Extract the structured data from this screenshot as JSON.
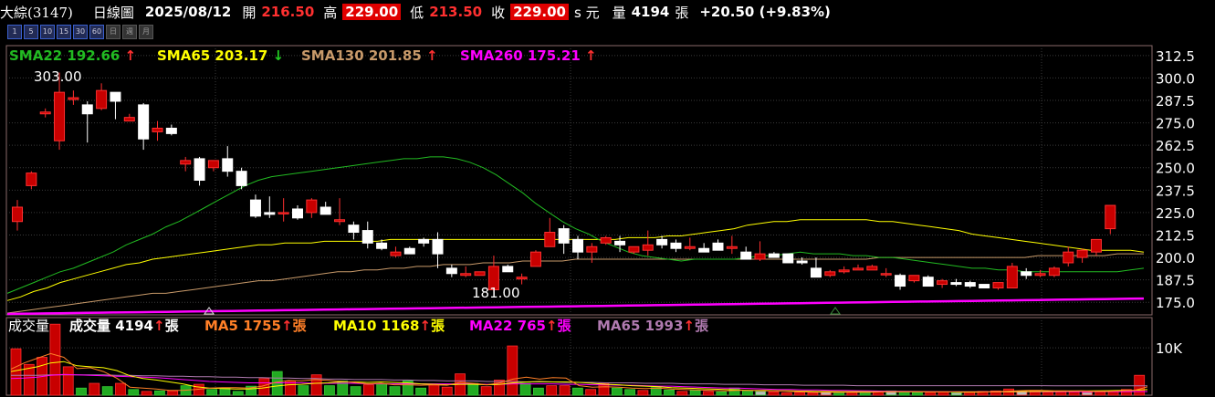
{
  "header": {
    "stock": "大綜(3147)",
    "period": "日線圖",
    "date": "2025/08/12",
    "open_label": "開",
    "open": "216.50",
    "high_label": "高",
    "high": "229.00",
    "low_label": "低",
    "low": "213.50",
    "close_label": "收",
    "close": "229.00",
    "unit": "s 元",
    "volume_label": "量",
    "volume": "4194",
    "volume_unit": "張",
    "change": "+20.50 (+9.83%)"
  },
  "period_buttons": [
    "1",
    "5",
    "10",
    "15",
    "30",
    "60",
    "日",
    "週",
    "月"
  ],
  "colors": {
    "up": "#c80000",
    "up_border": "#ff3030",
    "down": "#ffffff",
    "sma22": "#22bb22",
    "sma65": "#ffff00",
    "sma130": "#c89a6a",
    "sma260": "#ff00ff",
    "ma5": "#ff7f27",
    "ma10": "#ffff00",
    "ma22": "#ff00ff",
    "ma65": "#b07ab0",
    "grid": "#3a3a3a",
    "axis_text": "#ffffff"
  },
  "chart_data": {
    "type": "candlestick",
    "ylim": [
      168,
      318
    ],
    "y_ticks": [
      "312.5",
      "300.0",
      "287.5",
      "275.0",
      "262.5",
      "250.0",
      "237.5",
      "225.0",
      "212.5",
      "200.0",
      "187.5",
      "175.0"
    ],
    "annotations": {
      "high": "303.00",
      "low": "181.00"
    },
    "sma_legend": [
      {
        "name": "SMA22",
        "value": "192.66",
        "arrow": "↑",
        "color": "#22bb22"
      },
      {
        "name": "SMA65",
        "value": "203.17",
        "arrow": "↓",
        "color": "#ffff00"
      },
      {
        "name": "SMA130",
        "value": "201.85",
        "arrow": "↑",
        "color": "#c89a6a"
      },
      {
        "name": "SMA260",
        "value": "175.21",
        "arrow": "↑",
        "color": "#ff00ff"
      }
    ],
    "candles": [
      [
        220,
        232,
        215,
        228
      ],
      [
        240,
        248,
        238,
        247
      ],
      [
        280,
        283,
        278,
        281
      ],
      [
        265,
        303,
        260,
        292
      ],
      [
        288,
        293,
        285,
        289
      ],
      [
        285,
        287,
        264,
        280
      ],
      [
        283,
        297,
        282,
        293
      ],
      [
        292,
        292,
        277,
        287
      ],
      [
        276,
        280,
        276,
        278
      ],
      [
        285,
        286,
        260,
        266
      ],
      [
        270,
        276,
        265,
        272
      ],
      [
        272,
        274,
        268,
        269
      ],
      [
        252,
        256,
        248,
        254
      ],
      [
        255,
        256,
        240,
        243
      ],
      [
        250,
        254,
        248,
        254
      ],
      [
        255,
        262,
        245,
        248
      ],
      [
        248,
        250,
        238,
        240
      ],
      [
        232,
        235,
        222,
        223
      ],
      [
        225,
        234,
        222,
        224
      ],
      [
        225,
        233,
        220,
        225
      ],
      [
        227,
        229,
        221,
        222
      ],
      [
        225,
        233,
        222,
        232
      ],
      [
        228,
        231,
        224,
        224
      ],
      [
        220,
        233,
        218,
        221
      ],
      [
        218,
        220,
        210,
        214
      ],
      [
        215,
        220,
        205,
        208
      ],
      [
        208,
        210,
        204,
        205
      ],
      [
        201,
        206,
        200,
        203
      ],
      [
        205,
        206,
        203,
        202
      ],
      [
        210,
        211,
        206,
        208
      ],
      [
        210,
        214,
        194,
        202
      ],
      [
        194,
        196,
        189,
        191
      ],
      [
        190,
        195,
        189,
        191
      ],
      [
        190,
        192,
        190,
        192
      ],
      [
        182,
        201,
        181,
        195
      ],
      [
        195,
        196,
        192,
        192
      ],
      [
        188,
        191,
        185,
        189
      ],
      [
        195,
        204,
        195,
        203
      ],
      [
        206,
        222,
        206,
        214
      ],
      [
        216,
        218,
        202,
        208
      ],
      [
        210,
        212,
        199,
        203
      ],
      [
        203,
        208,
        197,
        206
      ],
      [
        208,
        212,
        207,
        211
      ],
      [
        209,
        212,
        203,
        207
      ],
      [
        203,
        206,
        202,
        206
      ],
      [
        204,
        215,
        201,
        207
      ],
      [
        210,
        212,
        205,
        207
      ],
      [
        208,
        210,
        203,
        205
      ],
      [
        205,
        211,
        204,
        206
      ],
      [
        205,
        208,
        203,
        203
      ],
      [
        208,
        210,
        204,
        204
      ],
      [
        205,
        212,
        202,
        206
      ],
      [
        203,
        206,
        199,
        199
      ],
      [
        199,
        209,
        198,
        202
      ],
      [
        202,
        203,
        200,
        200
      ],
      [
        202,
        202,
        198,
        197
      ],
      [
        198,
        200,
        196,
        197
      ],
      [
        194,
        200,
        193,
        189
      ],
      [
        190,
        193,
        189,
        192
      ],
      [
        192,
        195,
        191,
        193
      ],
      [
        193,
        196,
        194,
        194
      ],
      [
        193,
        196,
        194,
        195
      ],
      [
        191,
        194,
        189,
        191
      ],
      [
        190,
        191,
        182,
        184
      ],
      [
        187,
        190,
        186,
        190
      ],
      [
        189,
        190,
        184,
        184
      ],
      [
        185,
        188,
        183,
        187
      ],
      [
        186,
        188,
        184,
        185
      ],
      [
        186,
        187,
        183,
        184
      ],
      [
        185,
        185,
        183,
        183
      ],
      [
        183,
        186,
        182,
        186
      ],
      [
        183,
        197,
        183,
        195
      ],
      [
        192,
        194,
        188,
        190
      ],
      [
        190,
        193,
        189,
        191
      ],
      [
        190,
        195,
        189,
        194
      ],
      [
        197,
        206,
        195,
        203
      ],
      [
        200,
        205,
        197,
        204
      ],
      [
        203,
        210,
        201,
        210
      ],
      [
        216,
        229,
        213,
        229
      ]
    ],
    "sma22": [
      180,
      183,
      186,
      189,
      192,
      194,
      197,
      200,
      203,
      207,
      210,
      213,
      217,
      220,
      224,
      228,
      232,
      236,
      240,
      243,
      245,
      246,
      247,
      248,
      249,
      250,
      251,
      252,
      253,
      254,
      255,
      255,
      256,
      256,
      255,
      253,
      250,
      246,
      241,
      236,
      230,
      225,
      220,
      216,
      213,
      209,
      206,
      203,
      201,
      200,
      199,
      198,
      199,
      199,
      199,
      199,
      200,
      201,
      201,
      202,
      203,
      202,
      202,
      202,
      201,
      201,
      200,
      200,
      199,
      198,
      197,
      196,
      195,
      194,
      194,
      193,
      193,
      192,
      192,
      192,
      192,
      192,
      192,
      192,
      192,
      193,
      194
    ],
    "sma65": [
      176,
      178,
      181,
      183,
      186,
      188,
      190,
      192,
      194,
      196,
      197,
      199,
      200,
      201,
      202,
      203,
      204,
      205,
      206,
      207,
      207,
      208,
      208,
      208,
      209,
      209,
      209,
      209,
      209,
      210,
      210,
      210,
      210,
      210,
      210,
      210,
      210,
      210,
      210,
      210,
      210,
      210,
      210,
      210,
      210,
      210,
      210,
      211,
      211,
      211,
      212,
      212,
      213,
      214,
      215,
      216,
      218,
      219,
      220,
      220,
      221,
      221,
      221,
      221,
      221,
      221,
      220,
      220,
      219,
      218,
      217,
      216,
      215,
      213,
      212,
      211,
      210,
      209,
      208,
      207,
      206,
      205,
      204,
      204,
      204,
      204,
      203
    ],
    "sma130": [
      169,
      170,
      171,
      172,
      173,
      174,
      175,
      176,
      177,
      178,
      179,
      180,
      180,
      181,
      182,
      183,
      184,
      185,
      186,
      187,
      187,
      188,
      189,
      190,
      191,
      192,
      192,
      193,
      193,
      194,
      194,
      195,
      195,
      196,
      196,
      196,
      197,
      197,
      197,
      198,
      198,
      198,
      198,
      199,
      199,
      199,
      199,
      199,
      199,
      199,
      199,
      199,
      199,
      199,
      199,
      199,
      199,
      199,
      199,
      199,
      199,
      199,
      199,
      199,
      199,
      199,
      200,
      200,
      200,
      200,
      200,
      200,
      200,
      200,
      200,
      200,
      200,
      200,
      201,
      201,
      201,
      201,
      201,
      201,
      202,
      202,
      202
    ],
    "sma260": [
      168.5,
      168.6,
      168.7,
      168.8,
      168.9,
      169,
      169.1,
      169.2,
      169.3,
      169.4,
      169.5,
      169.6,
      169.7,
      169.8,
      169.9,
      170,
      170.1,
      170.2,
      170.3,
      170.4,
      170.5,
      170.6,
      170.7,
      170.8,
      170.9,
      171,
      171.1,
      171.2,
      171.3,
      171.4,
      171.5,
      171.6,
      171.7,
      171.8,
      171.9,
      172,
      172.1,
      172.2,
      172.3,
      172.4,
      172.5,
      172.6,
      172.7,
      172.8,
      172.9,
      173,
      173.1,
      173.2,
      173.3,
      173.4,
      173.5,
      173.6,
      173.7,
      173.8,
      173.9,
      174,
      174.1,
      174.2,
      174.3,
      174.4,
      174.5,
      174.6,
      174.7,
      174.8,
      174.9,
      175,
      175.1,
      175.2,
      175.3,
      175.4,
      175.5,
      175.6,
      175.7,
      175.8,
      175.9,
      176,
      176.1,
      176.2,
      176.3,
      176.4,
      176.5,
      176.6,
      176.7,
      176.8,
      176.9,
      177,
      177.1
    ],
    "volume_panel": {
      "title": "成交量",
      "y_tick": "10K",
      "ylim": [
        0,
        16000
      ],
      "legend": [
        {
          "name": "成交量",
          "value": "4194",
          "arrow": "↑",
          "unit": "張",
          "color": "#ffffff"
        },
        {
          "name": "MA5",
          "value": "1755",
          "arrow": "↑",
          "unit": "張",
          "color": "#ff7f27"
        },
        {
          "name": "MA10",
          "value": "1168",
          "arrow": "↑",
          "unit": "張",
          "color": "#ffff00"
        },
        {
          "name": "MA22",
          "value": "765",
          "arrow": "↑",
          "unit": "張",
          "color": "#ff00ff"
        },
        {
          "name": "MA65",
          "value": "1993",
          "arrow": "↑",
          "unit": "張",
          "color": "#b07ab0"
        }
      ],
      "volumes": [
        9800,
        6500,
        8000,
        15000,
        6000,
        1500,
        2500,
        1800,
        2500,
        1200,
        800,
        900,
        900,
        2000,
        2300,
        1200,
        1500,
        800,
        1900,
        3500,
        5000,
        3000,
        2000,
        4300,
        2000,
        3000,
        1800,
        2200,
        2400,
        1800,
        3000,
        1500,
        2200,
        1700,
        4500,
        2500,
        1800,
        3200,
        10400,
        2500,
        1500,
        2000,
        2000,
        1500,
        1200,
        2500,
        1500,
        1200,
        1000,
        1600,
        1100,
        800,
        1000,
        800,
        700,
        1500,
        1000,
        800,
        700,
        500,
        600,
        500,
        800,
        700,
        600,
        700,
        800,
        900,
        700,
        600,
        600,
        700,
        500,
        700,
        800,
        900,
        1300,
        900,
        1000,
        800,
        900,
        700,
        600,
        800,
        900,
        1200,
        4200
      ],
      "ma5": [
        5500,
        6800,
        7800,
        8800,
        8000,
        5600,
        5800,
        5000,
        3600,
        1700,
        1500,
        1300,
        1000,
        1000,
        1200,
        1500,
        1600,
        1600,
        1500,
        1900,
        2700,
        3100,
        3000,
        3300,
        3100,
        2900,
        2700,
        2400,
        2500,
        2200,
        2200,
        2100,
        2200,
        2100,
        2700,
        2500,
        2200,
        2600,
        3400,
        3800,
        3400,
        3700,
        3600,
        2000,
        1700,
        1800,
        1700,
        1500,
        1400,
        1500,
        1300,
        1200,
        1100,
        1000,
        900,
        1000,
        1000,
        900,
        900,
        800,
        700,
        600,
        600,
        600,
        600,
        600,
        700,
        700,
        700,
        700,
        700,
        700,
        600,
        600,
        700,
        800,
        900,
        1000,
        1000,
        900,
        900,
        900,
        800,
        800,
        900,
        1000,
        1755
      ],
      "ma10": [
        5000,
        5500,
        6000,
        6800,
        7100,
        6200,
        6000,
        5800,
        5200,
        4100,
        3500,
        3200,
        2800,
        2400,
        1800,
        1500,
        1400,
        1300,
        1300,
        1500,
        1900,
        2200,
        2300,
        2500,
        2600,
        2800,
        2800,
        2700,
        2800,
        2700,
        2600,
        2400,
        2300,
        2200,
        2300,
        2300,
        2200,
        2300,
        2600,
        2800,
        2900,
        2800,
        2800,
        2700,
        2500,
        2300,
        2200,
        2000,
        1900,
        1800,
        1600,
        1500,
        1400,
        1300,
        1200,
        1100,
        1000,
        1000,
        950,
        900,
        850,
        800,
        780,
        760,
        750,
        740,
        730,
        720,
        720,
        710,
        700,
        700,
        700,
        700,
        700,
        720,
        750,
        780,
        800,
        820,
        850,
        880,
        900,
        950,
        1000,
        1050,
        1168
      ],
      "ma22": [
        3500,
        3600,
        3800,
        4200,
        4400,
        4300,
        4200,
        4100,
        4000,
        3900,
        3800,
        3700,
        3500,
        3300,
        3100,
        2900,
        2800,
        2700,
        2600,
        2600,
        2600,
        2600,
        2600,
        2500,
        2500,
        2500,
        2500,
        2400,
        2400,
        2400,
        2400,
        2400,
        2400,
        2400,
        2400,
        2400,
        2300,
        2300,
        2400,
        2400,
        2400,
        2400,
        2300,
        2300,
        2200,
        2200,
        2100,
        2100,
        2000,
        1900,
        1900,
        1800,
        1700,
        1600,
        1500,
        1500,
        1400,
        1300,
        1200,
        1200,
        1100,
        1100,
        1000,
        1000,
        950,
        900,
        850,
        820,
        800,
        780,
        760,
        740,
        730,
        720,
        720,
        720,
        720,
        730,
        740,
        740,
        750,
        750,
        750,
        750,
        760,
        765,
        765
      ],
      "ma65": [
        4200,
        4200,
        4200,
        4300,
        4300,
        4300,
        4300,
        4300,
        4200,
        4200,
        4100,
        4100,
        4000,
        4000,
        3900,
        3900,
        3800,
        3800,
        3700,
        3700,
        3600,
        3600,
        3500,
        3500,
        3400,
        3400,
        3300,
        3300,
        3300,
        3200,
        3200,
        3100,
        3100,
        3000,
        3000,
        3000,
        2900,
        2900,
        2900,
        2800,
        2800,
        2800,
        2700,
        2700,
        2700,
        2600,
        2600,
        2600,
        2500,
        2500,
        2500,
        2400,
        2400,
        2400,
        2300,
        2300,
        2300,
        2200,
        2200,
        2200,
        2100,
        2100,
        2100,
        2100,
        2000,
        2000,
        2000,
        2000,
        2000,
        2000,
        2000,
        2000,
        2000,
        2000,
        2000,
        2000,
        2000,
        2000,
        2000,
        1990,
        1990,
        1990,
        1990,
        1990,
        1993,
        1993,
        1993
      ]
    }
  }
}
